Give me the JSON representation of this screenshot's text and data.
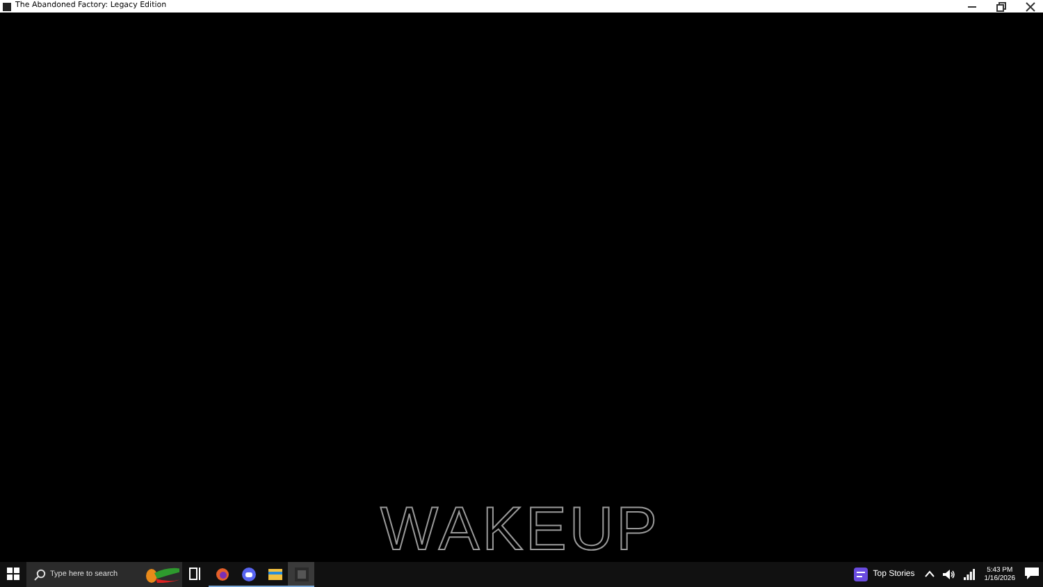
{
  "window": {
    "title": "The Abandoned Factory: Legacy Edition"
  },
  "game": {
    "caption": "WAKEUP"
  },
  "taskbar": {
    "search": {
      "placeholder": "Type here to search"
    },
    "apps": [
      {
        "kind": "firefox",
        "active": false
      },
      {
        "kind": "discord",
        "active": false
      },
      {
        "kind": "folder",
        "active": false
      },
      {
        "kind": "game",
        "active": true
      }
    ],
    "news": "Top Stories",
    "time": "5:43 PM",
    "date": "1/16/2026"
  }
}
